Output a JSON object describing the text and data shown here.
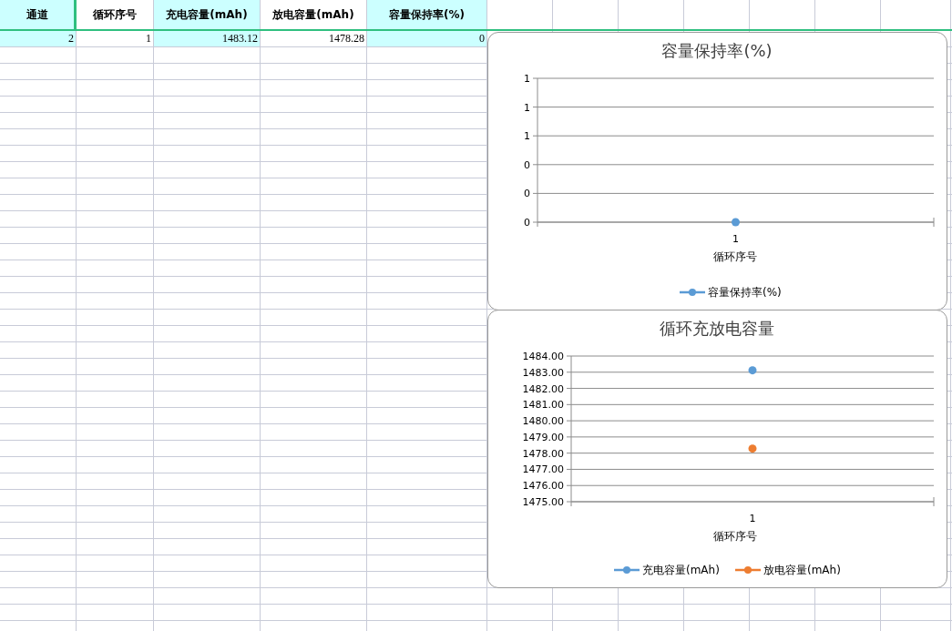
{
  "table": {
    "columns": [
      {
        "label": "通道",
        "shaded": true
      },
      {
        "label": "循环序号",
        "shaded": false
      },
      {
        "label": "充电容量(mAh)",
        "shaded": true
      },
      {
        "label": "放电容量(mAh)",
        "shaded": false
      },
      {
        "label": "容量保持率(%)",
        "shaded": true
      }
    ],
    "rows": [
      {
        "cells": [
          "2",
          "1",
          "1483.12",
          "1478.28",
          "0"
        ]
      }
    ]
  },
  "charts": [
    {
      "chart_data": {
        "type": "line",
        "title": "容量保持率(%)",
        "xlabel": "循环序号",
        "categories": [
          "1"
        ],
        "ylim": [
          0,
          1
        ],
        "grid": true,
        "legend": "bottom",
        "yticks": [
          {
            "value": 0,
            "label": "0"
          },
          {
            "value": 0.2,
            "label": "0"
          },
          {
            "value": 0.4,
            "label": "0"
          },
          {
            "value": 0.6,
            "label": "1"
          },
          {
            "value": 0.8,
            "label": "1"
          },
          {
            "value": 1,
            "label": "1"
          }
        ],
        "series": [
          {
            "name": "容量保持率(%)",
            "color": "#5b9bd5",
            "marker": "circle",
            "values": [
              0
            ]
          }
        ]
      }
    },
    {
      "chart_data": {
        "type": "line",
        "title": "循环充放电容量",
        "xlabel": "循环序号",
        "categories": [
          "1"
        ],
        "ylim": [
          1475,
          1484
        ],
        "grid": true,
        "legend": "bottom",
        "yticks": [
          {
            "value": 1475,
            "label": "1475.00"
          },
          {
            "value": 1476,
            "label": "1476.00"
          },
          {
            "value": 1477,
            "label": "1477.00"
          },
          {
            "value": 1478,
            "label": "1478.00"
          },
          {
            "value": 1479,
            "label": "1479.00"
          },
          {
            "value": 1480,
            "label": "1480.00"
          },
          {
            "value": 1481,
            "label": "1481.00"
          },
          {
            "value": 1482,
            "label": "1482.00"
          },
          {
            "value": 1483,
            "label": "1483.00"
          },
          {
            "value": 1484,
            "label": "1484.00"
          }
        ],
        "series": [
          {
            "name": "充电容量(mAh)",
            "color": "#5b9bd5",
            "marker": "circle",
            "values": [
              1483.12
            ]
          },
          {
            "name": "放电容量(mAh)",
            "color": "#ed7d31",
            "marker": "circle",
            "values": [
              1478.28
            ]
          }
        ]
      }
    }
  ]
}
